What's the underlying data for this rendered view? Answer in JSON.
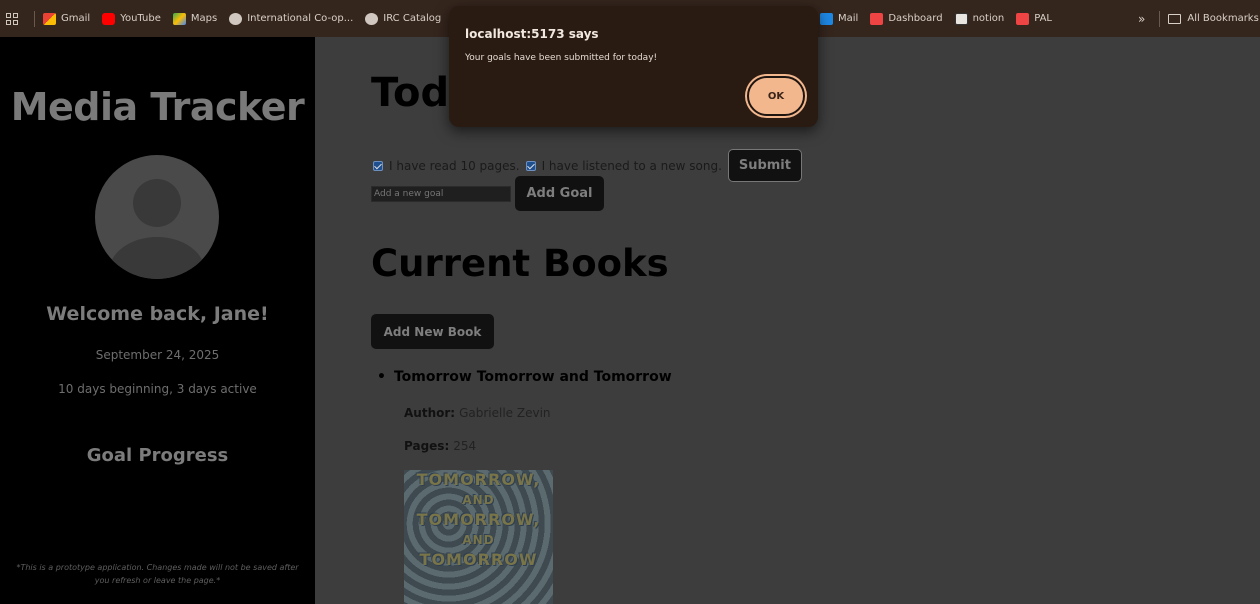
{
  "bookmarks": {
    "items": [
      {
        "label": "Gmail",
        "icon": "gmail-icon"
      },
      {
        "label": "YouTube",
        "icon": "youtube-icon"
      },
      {
        "label": "Maps",
        "icon": "maps-icon"
      },
      {
        "label": "International Co-op...",
        "icon": "globe-icon"
      },
      {
        "label": "IRC Catalog",
        "icon": "globe-icon"
      }
    ],
    "right_items": [
      {
        "label": "Mail",
        "icon": "outlook-icon"
      },
      {
        "label": "Dashboard",
        "icon": "dashboard-icon"
      },
      {
        "label": "notion",
        "icon": "notion-icon"
      },
      {
        "label": "PAL",
        "icon": "pal-icon"
      }
    ],
    "overflow": "»",
    "all_bookmarks": "All Bookmarks"
  },
  "sidebar": {
    "brand": "Media Tracker",
    "welcome": "Welcome back, Jane!",
    "date": "September 24, 2025",
    "streak": "10 days beginning, 3 days active",
    "goal_progress": "Goal Progress",
    "disclaimer": "*This is a prototype application. Changes made will not be saved after you refresh or leave the page.*"
  },
  "main": {
    "today_heading": "Tod",
    "goals": [
      {
        "label": "I have read 10 pages.",
        "checked": true
      },
      {
        "label": "I have listened to a new song.",
        "checked": true
      }
    ],
    "submit_label": "Submit",
    "goal_input_placeholder": "Add a new goal",
    "add_goal_label": "Add Goal",
    "books_heading": "Current Books",
    "add_book_label": "Add New Book",
    "book": {
      "title": "Tomorrow Tomorrow and Tomorrow",
      "author_label": "Author:",
      "author": "Gabrielle Zevin",
      "pages_label": "Pages:",
      "pages": "254",
      "cover_lines": [
        "TOMORROW,",
        "AND",
        "TOMORROW,",
        "AND",
        "TOMORROW"
      ]
    }
  },
  "dialog": {
    "title": "localhost:5173 says",
    "message": "Your goals have been submitted for today!",
    "ok_label": "OK"
  },
  "colors": {
    "bookmarks_bg": "#35261d",
    "sidebar_bg": "#000000",
    "main_bg": "#3d3d3d",
    "dialog_bg": "#2a1b12",
    "ok_button": "#f3b78e"
  }
}
